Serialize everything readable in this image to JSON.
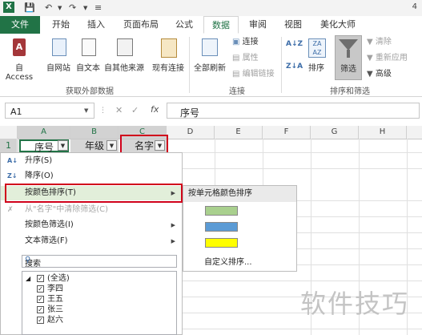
{
  "titlebar": {
    "excel_icon": "excel-icon",
    "save_icon": "save-icon",
    "undo_icon": "undo-icon",
    "redo_icon": "redo-icon",
    "customize_icon": "customize-icon",
    "title_fragment": "4"
  },
  "tabs": [
    "文件",
    "开始",
    "插入",
    "页面布局",
    "公式",
    "数据",
    "审阅",
    "视图",
    "美化大师"
  ],
  "active_tab": "数据",
  "ribbon": {
    "get_external": {
      "buttons": [
        "自 Access",
        "自网站",
        "自文本",
        "自其他来源",
        "现有连接"
      ],
      "group_label": "获取外部数据"
    },
    "connections": {
      "refresh_all": "全部刷新",
      "connections": "连接",
      "properties": "属性",
      "edit_links": "编辑链接",
      "group_label": "连接"
    },
    "sort_filter": {
      "sort": "排序",
      "filter": "筛选",
      "clear": "清除",
      "reapply": "重新应用",
      "advanced": "高级",
      "group_label": "排序和筛选"
    }
  },
  "formula_bar": {
    "name_box": "A1",
    "fx": "fx",
    "content": "序号"
  },
  "columns": [
    "A",
    "B",
    "C",
    "D",
    "E",
    "F",
    "G",
    "H"
  ],
  "row_number": "1",
  "headers": [
    "序号",
    "年级",
    "名字"
  ],
  "menu": {
    "items": [
      "升序(S)",
      "降序(O)",
      "按颜色排序(T)",
      "从\"名字\"中清除筛选(C)",
      "按颜色筛选(I)",
      "文本筛选(F)"
    ],
    "search_placeholder": "搜索",
    "list": [
      "(全选)",
      "李四",
      "王五",
      "张三",
      "赵六"
    ]
  },
  "submenu": {
    "title": "按单元格颜色排序",
    "colors": [
      "#a9d08e",
      "#5b9bd5",
      "#ffff00"
    ],
    "custom": "自定义排序..."
  },
  "watermark": "软件技巧"
}
